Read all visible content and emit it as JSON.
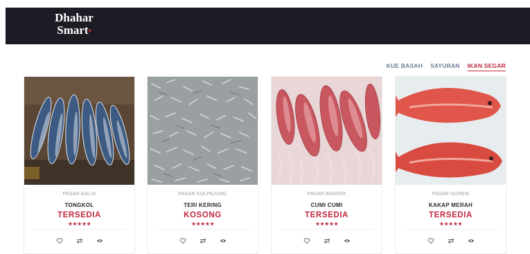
{
  "brand": {
    "line1": "Dhahar",
    "line2": "Smart",
    "dot": "•",
    "dot_color": "#e0203a"
  },
  "tabs": [
    {
      "label": "KUE BASAH",
      "active": false
    },
    {
      "label": "SAYURAN",
      "active": false
    },
    {
      "label": "IKAN SEGAR",
      "active": true
    }
  ],
  "colors": {
    "accent": "#c0283f",
    "header_bg": "#1c1c24",
    "tab_inactive": "#6d7d95"
  },
  "products": [
    {
      "market": "PASAR GALIS",
      "name": "TONGKOL",
      "status": "TERSEDIA",
      "rating": "★★★★★",
      "stars": 5,
      "icons": [
        "heart-icon",
        "compare-icon",
        "eye-icon"
      ]
    },
    {
      "market": "PASAR KOLPAJUNG",
      "name": "TERI KERING",
      "status": "KOSONG",
      "rating": "★★★★★",
      "stars": 5,
      "icons": [
        "heart-icon",
        "compare-icon",
        "eye-icon"
      ]
    },
    {
      "market": "PASAR BRANTA",
      "name": "CUMI CUMI",
      "status": "TERSEDIA",
      "rating": "★★★★★",
      "stars": 5,
      "icons": [
        "heart-icon",
        "compare-icon",
        "eye-icon"
      ]
    },
    {
      "market": "PASAR GUREM",
      "name": "KAKAP MERAH",
      "status": "TERSEDIA",
      "rating": "★★★★★",
      "stars": 5,
      "icons": [
        "heart-icon",
        "compare-icon",
        "eye-icon"
      ]
    }
  ]
}
